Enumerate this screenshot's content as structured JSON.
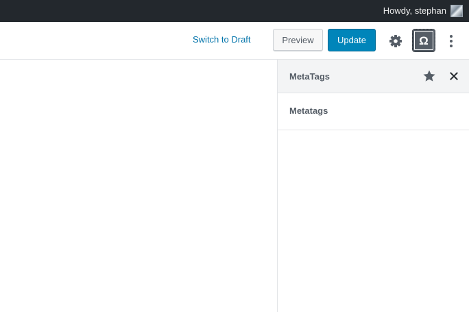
{
  "admin_bar": {
    "greeting": "Howdy, stephan",
    "background_color": "#23282d"
  },
  "header": {
    "switch_to_draft_label": "Switch to Draft",
    "preview_label": "Preview",
    "update_label": "Update",
    "settings_icon": "gear-icon",
    "plugin_icon": "omega-icon",
    "plugin_glyph": "Ω",
    "more_icon": "more-vertical-icon",
    "accent_color": "#0085ba"
  },
  "sidebar": {
    "title": "MetaTags",
    "star_icon": "star-icon",
    "close_icon": "close-icon",
    "panel_label": "Metatags"
  }
}
